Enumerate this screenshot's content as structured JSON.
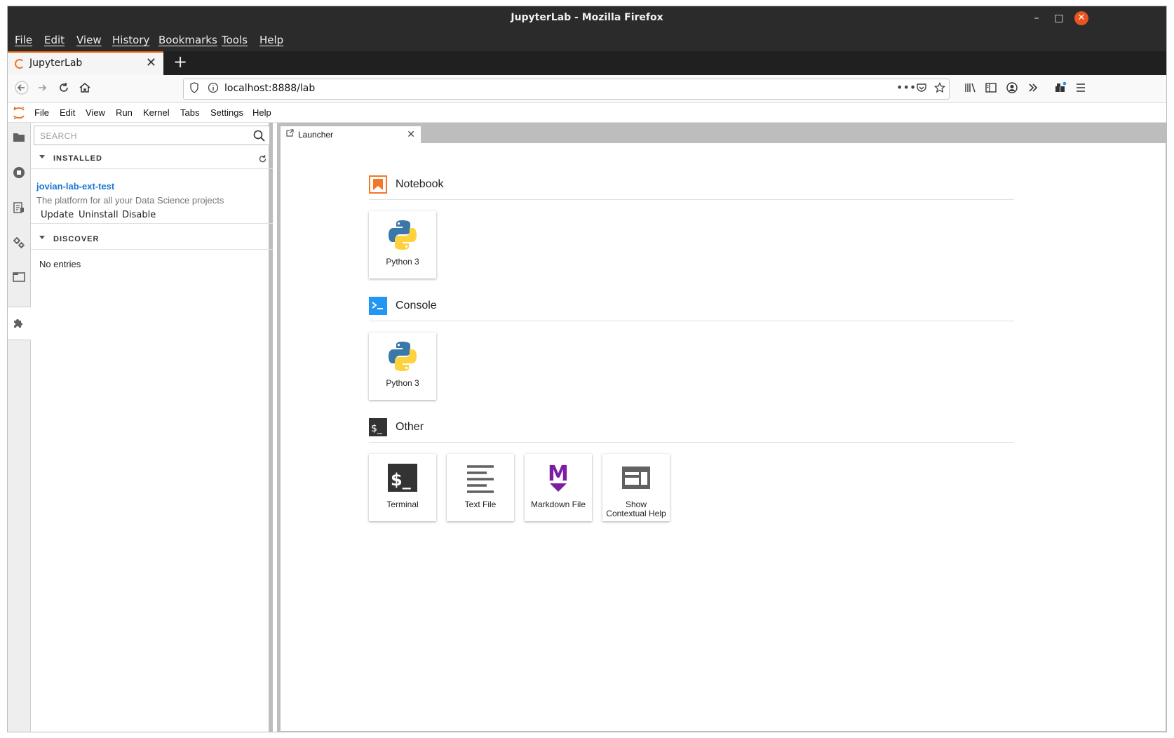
{
  "window": {
    "title": "JupyterLab - Mozilla Firefox",
    "minimize": "–",
    "maximize": "□",
    "close": "✕"
  },
  "firefox_menu": [
    "File",
    "Edit",
    "View",
    "History",
    "Bookmarks",
    "Tools",
    "Help"
  ],
  "browser_tab": {
    "label": "JupyterLab",
    "close": "✕",
    "new_tab": "+"
  },
  "navbar": {
    "url": "localhost:8888/lab"
  },
  "jupyter_menu": [
    "File",
    "Edit",
    "View",
    "Run",
    "Kernel",
    "Tabs",
    "Settings",
    "Help"
  ],
  "extension_manager": {
    "search_placeholder": "SEARCH",
    "installed_header": "INSTALLED",
    "discover_header": "DISCOVER",
    "installed": [
      {
        "name": "jovian-lab-ext-test",
        "description": "The platform for all your Data Science projects",
        "actions": [
          "Update",
          "Uninstall",
          "Disable"
        ]
      }
    ],
    "discover_empty": "No entries"
  },
  "doc_tab": {
    "label": "Launcher",
    "close": "✕"
  },
  "launcher": {
    "notebook": {
      "title": "Notebook",
      "cards": [
        "Python 3"
      ]
    },
    "console": {
      "title": "Console",
      "cards": [
        "Python 3"
      ]
    },
    "other": {
      "title": "Other",
      "cards": [
        "Terminal",
        "Text File",
        "Markdown File",
        "Show Contextual Help"
      ]
    }
  },
  "colors": {
    "jupyter_orange": "#f37726",
    "console_blue": "#2196f3",
    "markdown_purple": "#7b1fa2",
    "link_blue": "#1976d2"
  }
}
